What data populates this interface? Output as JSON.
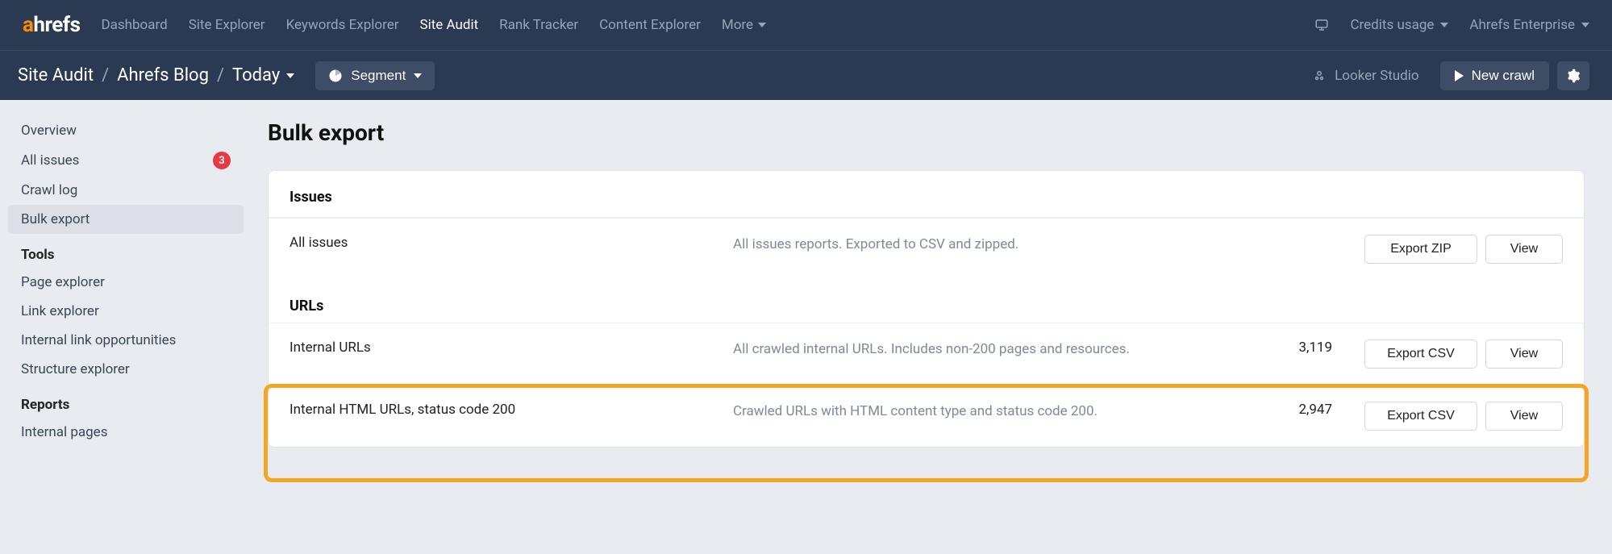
{
  "nav": {
    "logo_a": "a",
    "logo_rest": "hrefs",
    "items": [
      {
        "label": "Dashboard",
        "active": false
      },
      {
        "label": "Site Explorer",
        "active": false
      },
      {
        "label": "Keywords Explorer",
        "active": false
      },
      {
        "label": "Site Audit",
        "active": true
      },
      {
        "label": "Rank Tracker",
        "active": false
      },
      {
        "label": "Content Explorer",
        "active": false
      },
      {
        "label": "More",
        "active": false,
        "dropdown": true
      }
    ],
    "right": {
      "credits": "Credits usage",
      "account": "Ahrefs Enterprise"
    }
  },
  "subnav": {
    "crumb1": "Site Audit",
    "crumb2": "Ahrefs Blog",
    "crumb3": "Today",
    "segment": "Segment",
    "looker": "Looker Studio",
    "new_crawl": "New crawl"
  },
  "sidebar": {
    "items": [
      {
        "label": "Overview",
        "active": false
      },
      {
        "label": "All issues",
        "active": false,
        "badge": "3"
      },
      {
        "label": "Crawl log",
        "active": false
      },
      {
        "label": "Bulk export",
        "active": true
      }
    ],
    "tools_head": "Tools",
    "tools": [
      {
        "label": "Page explorer"
      },
      {
        "label": "Link explorer"
      },
      {
        "label": "Internal link opportunities"
      },
      {
        "label": "Structure explorer"
      }
    ],
    "reports_head": "Reports",
    "reports": [
      {
        "label": "Internal pages"
      }
    ]
  },
  "page": {
    "title": "Bulk export",
    "sections": {
      "issues_head": "Issues",
      "urls_head": "URLs"
    },
    "rows": {
      "all_issues": {
        "name": "All issues",
        "desc": "All issues reports. Exported to CSV and zipped.",
        "count": "",
        "export_label": "Export ZIP",
        "view_label": "View"
      },
      "internal_urls": {
        "name": "Internal URLs",
        "desc": "All crawled internal URLs. Includes non-200 pages and resources.",
        "count": "3,119",
        "export_label": "Export CSV",
        "view_label": "View"
      },
      "internal_html_200": {
        "name": "Internal HTML URLs, status code 200",
        "desc": "Crawled URLs with HTML content type and status code 200.",
        "count": "2,947",
        "export_label": "Export CSV",
        "view_label": "View"
      }
    }
  }
}
